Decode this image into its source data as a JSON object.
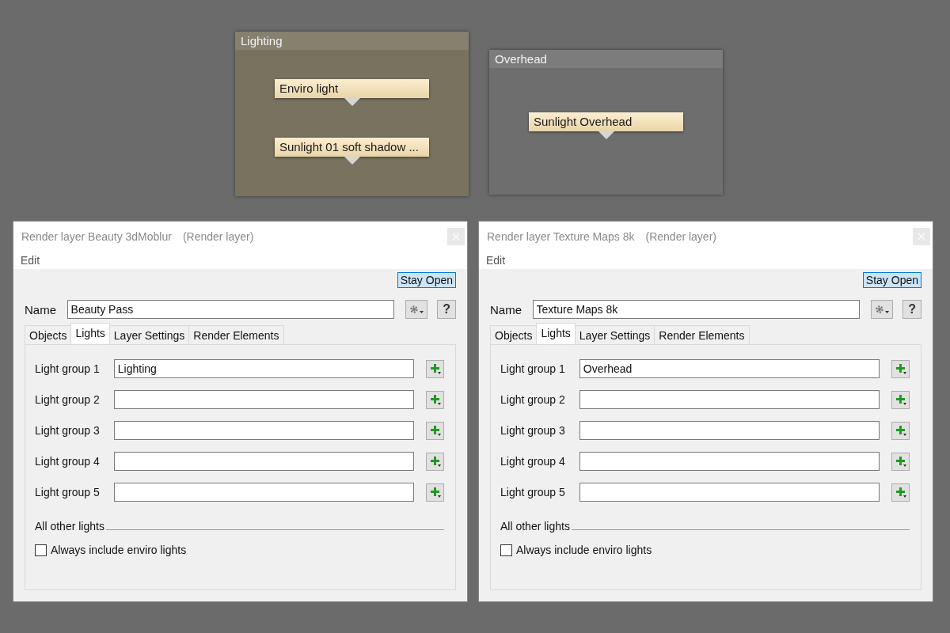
{
  "canvas": {
    "groups": [
      {
        "title": "Lighting",
        "color": "#79725f",
        "nodes": [
          "Enviro light",
          "Sunlight 01 soft shadow ..."
        ]
      },
      {
        "title": "Overhead",
        "color": "#6e6e6e",
        "nodes": [
          "Sunlight Overhead"
        ]
      }
    ]
  },
  "dialogs": [
    {
      "title": "Render layer Beauty 3dMoblur",
      "subtitle": "(Render layer)",
      "menu": [
        "Edit"
      ],
      "stay_open": "Stay Open",
      "name_label": "Name",
      "name_value": "Beauty Pass",
      "help": "?",
      "tabs": [
        {
          "label": "Objects",
          "selected": false
        },
        {
          "label": "Lights",
          "selected": true
        },
        {
          "label": "Layer Settings",
          "selected": false
        },
        {
          "label": "Render Elements",
          "selected": false
        }
      ],
      "light_groups": [
        {
          "label": "Light group 1",
          "value": "Lighting"
        },
        {
          "label": "Light group 2"
        },
        {
          "label": "Light group 3"
        },
        {
          "label": "Light group 4"
        },
        {
          "label": "Light group 5"
        }
      ],
      "section": "All other lights",
      "checkbox": {
        "label": "Always include enviro lights",
        "checked": false
      }
    },
    {
      "title": "Render layer Texture Maps 8k",
      "subtitle": "(Render layer)",
      "menu": [
        "Edit"
      ],
      "stay_open": "Stay Open",
      "name_label": "Name",
      "name_value": "Texture Maps 8k",
      "help": "?",
      "tabs": [
        {
          "label": "Objects",
          "selected": false
        },
        {
          "label": "Lights",
          "selected": true
        },
        {
          "label": "Layer Settings",
          "selected": false
        },
        {
          "label": "Render Elements",
          "selected": false
        }
      ],
      "light_groups": [
        {
          "label": "Light group 1",
          "value": "Overhead"
        },
        {
          "label": "Light group 2"
        },
        {
          "label": "Light group 3"
        },
        {
          "label": "Light group 4"
        },
        {
          "label": "Light group 5"
        }
      ],
      "section": "All other lights",
      "checkbox": {
        "label": "Always include enviro lights",
        "checked": false
      }
    }
  ]
}
